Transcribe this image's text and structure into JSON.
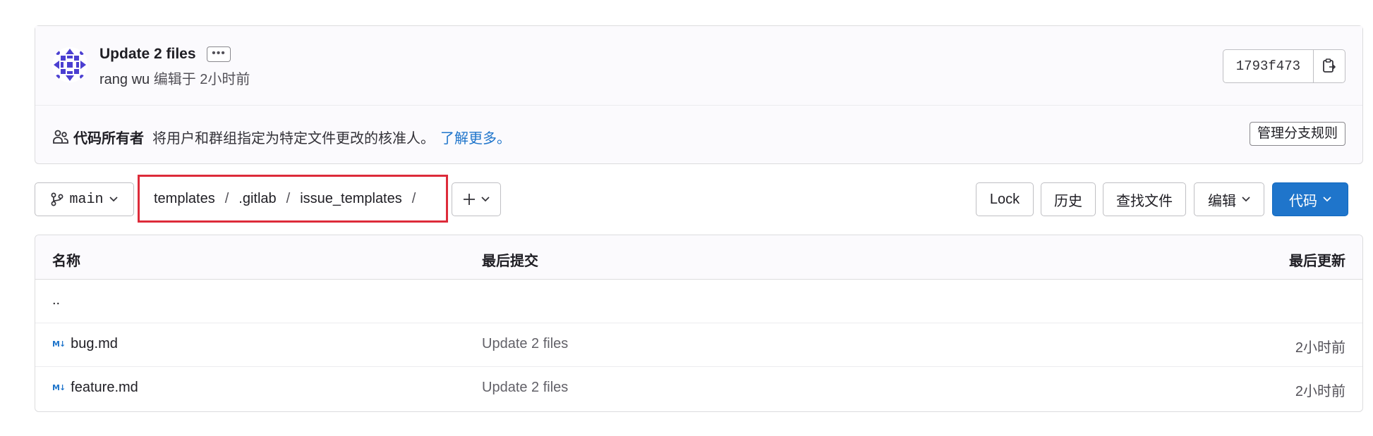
{
  "commit": {
    "title": "Update 2 files",
    "ellipsis": "•••",
    "author": "rang wu",
    "action": "编辑于",
    "time": "2小时前",
    "sha": "1793f473"
  },
  "code_owners": {
    "title": "代码所有者",
    "description": "将用户和群组指定为特定文件更改的核准人。",
    "link": "了解更多。",
    "manage_button": "管理分支规则"
  },
  "toolbar": {
    "branch": "main",
    "breadcrumb": [
      "templates",
      ".gitlab",
      "issue_templates"
    ],
    "separator": "/",
    "lock": "Lock",
    "history": "历史",
    "find_file": "查找文件",
    "edit": "编辑",
    "code": "代码"
  },
  "table": {
    "headers": {
      "name": "名称",
      "last_commit": "最后提交",
      "last_update": "最后更新"
    },
    "parent": "..",
    "rows": [
      {
        "name": "bug.md",
        "commit": "Update 2 files",
        "updated": "2小时前"
      },
      {
        "name": "feature.md",
        "commit": "Update 2 files",
        "updated": "2小时前"
      }
    ]
  },
  "colors": {
    "accent": "#1f75cb",
    "highlight_border": "#dd2b3a"
  }
}
